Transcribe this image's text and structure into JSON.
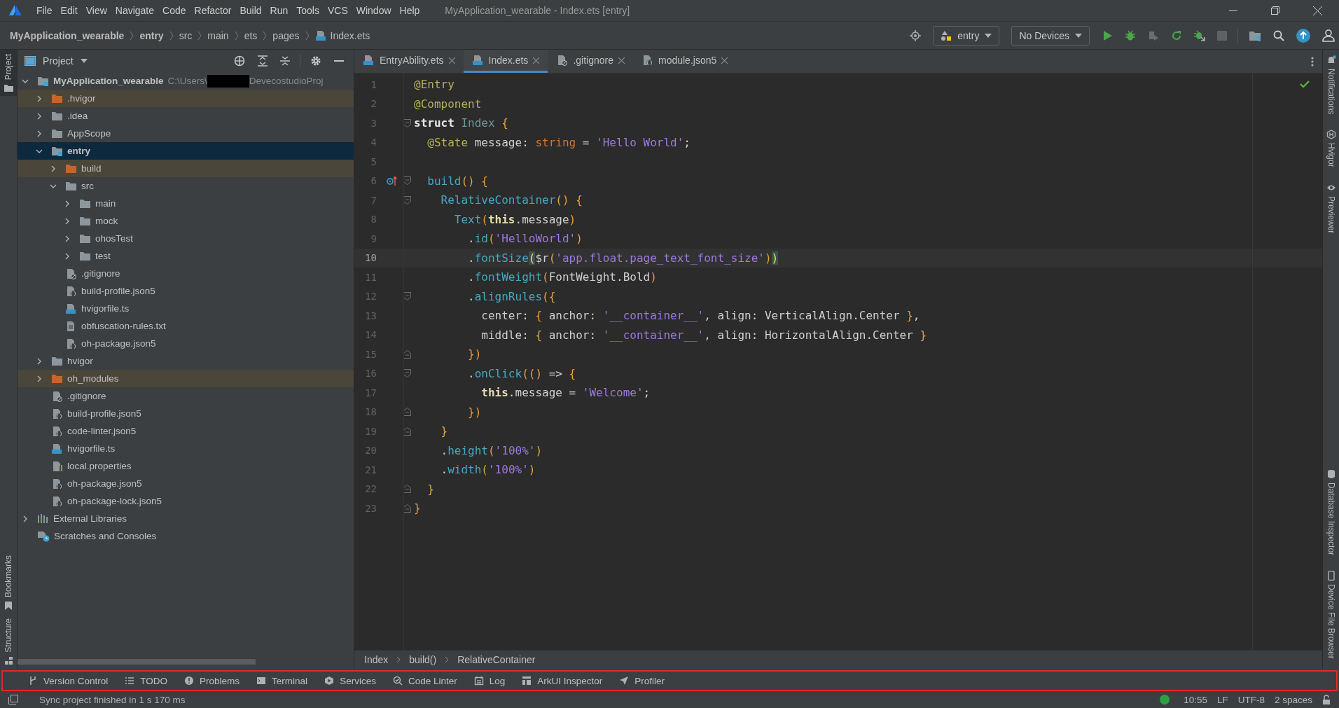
{
  "menu_bar": {
    "items": [
      "File",
      "Edit",
      "View",
      "Navigate",
      "Code",
      "Refactor",
      "Build",
      "Run",
      "Tools",
      "VCS",
      "Window",
      "Help"
    ],
    "title": "MyApplication_wearable - Index.ets [entry]"
  },
  "nav_bar": {
    "breadcrumbs": [
      {
        "text": "MyApplication_wearable",
        "kind": "project"
      },
      {
        "text": "entry",
        "kind": "module"
      },
      {
        "text": "src",
        "kind": "folder"
      },
      {
        "text": "main",
        "kind": "folder"
      },
      {
        "text": "ets",
        "kind": "folder"
      },
      {
        "text": "pages",
        "kind": "folder"
      },
      {
        "text": "Index.ets",
        "kind": "file"
      }
    ],
    "run_config": "entry",
    "device": "No Devices"
  },
  "left_strip_top": [
    {
      "label": "Project",
      "selected": true,
      "kind": "folder"
    }
  ],
  "left_strip_bottom": [
    {
      "label": "Bookmarks",
      "selected": false,
      "kind": "bookmark"
    },
    {
      "label": "Structure",
      "selected": false,
      "kind": "structure"
    }
  ],
  "project_panel": {
    "title": "Project",
    "tree": [
      {
        "name": "MyApplication_wearable",
        "kind": "project",
        "path_start": "C:\\Users\\",
        "redacted": true,
        "path_end": "DevecostudioProj",
        "expanded": true,
        "selected": false,
        "children": [
          {
            "name": ".hvigor",
            "kind": "excluded-folder",
            "expanded": false,
            "selected": false
          },
          {
            "name": ".idea",
            "kind": "folder",
            "expanded": false,
            "selected": false
          },
          {
            "name": "AppScope",
            "kind": "folder",
            "expanded": false,
            "selected": false
          },
          {
            "name": "entry",
            "kind": "module-folder",
            "expanded": true,
            "selected": true,
            "children": [
              {
                "name": "build",
                "kind": "excluded-folder",
                "expanded": false,
                "selected": false
              },
              {
                "name": "src",
                "kind": "folder",
                "expanded": true,
                "selected": false,
                "children": [
                  {
                    "name": "main",
                    "kind": "folder",
                    "expanded": false,
                    "selected": false
                  },
                  {
                    "name": "mock",
                    "kind": "folder",
                    "expanded": false,
                    "selected": false
                  },
                  {
                    "name": "ohosTest",
                    "kind": "folder",
                    "expanded": false,
                    "selected": false
                  },
                  {
                    "name": "test",
                    "kind": "folder",
                    "expanded": false,
                    "selected": false
                  }
                ]
              },
              {
                "name": ".gitignore",
                "kind": "file-ignore",
                "selected": false
              },
              {
                "name": "build-profile.json5",
                "kind": "file-json",
                "selected": false
              },
              {
                "name": "hvigorfile.ts",
                "kind": "file-ts",
                "selected": false
              },
              {
                "name": "obfuscation-rules.txt",
                "kind": "file-text",
                "selected": false
              },
              {
                "name": "oh-package.json5",
                "kind": "file-json",
                "selected": false
              }
            ]
          },
          {
            "name": "hvigor",
            "kind": "folder",
            "expanded": false,
            "selected": false
          },
          {
            "name": "oh_modules",
            "kind": "excluded-folder",
            "expanded": false,
            "selected": false
          },
          {
            "name": ".gitignore",
            "kind": "file-ignore",
            "selected": false
          },
          {
            "name": "build-profile.json5",
            "kind": "file-json",
            "selected": false
          },
          {
            "name": "code-linter.json5",
            "kind": "file-json",
            "selected": false
          },
          {
            "name": "hvigorfile.ts",
            "kind": "file-ts",
            "selected": false
          },
          {
            "name": "local.properties",
            "kind": "file-properties",
            "selected": false
          },
          {
            "name": "oh-package.json5",
            "kind": "file-json",
            "selected": false
          },
          {
            "name": "oh-package-lock.json5",
            "kind": "file-json",
            "selected": false
          }
        ]
      },
      {
        "name": "External Libraries",
        "kind": "libraries",
        "expanded": false,
        "selected": false
      },
      {
        "name": "Scratches and Consoles",
        "kind": "scratches",
        "selected": false
      }
    ]
  },
  "editor": {
    "tabs": [
      {
        "label": "EntryAbility.ets",
        "kind": "ets",
        "selected": false
      },
      {
        "label": "Index.ets",
        "kind": "ets",
        "selected": true
      },
      {
        "label": ".gitignore",
        "kind": "ignore",
        "selected": false
      },
      {
        "label": "module.json5",
        "kind": "json",
        "selected": false
      }
    ],
    "lines": [
      {
        "number": "1",
        "current": false,
        "kind": "plain",
        "tokens": [
          {
            "text": "@Entry",
            "kind": "ann"
          }
        ]
      },
      {
        "number": "2",
        "current": false,
        "kind": "plain",
        "tokens": [
          {
            "text": "@Component",
            "kind": "ann"
          }
        ]
      },
      {
        "number": "3",
        "current": false,
        "kind": "fold-start",
        "tokens": [
          {
            "text": "struct",
            "kind": "kw"
          },
          {
            "text": " Index",
            "kind": "cls"
          },
          {
            "text": " {",
            "kind": "br"
          }
        ]
      },
      {
        "number": "4",
        "current": false,
        "kind": "plain",
        "tokens": [
          {
            "text": "  @State",
            "kind": "ann"
          },
          {
            "text": " message: ",
            "kind": "plain"
          },
          {
            "text": "string",
            "kind": "type"
          },
          {
            "text": " = ",
            "kind": "plain"
          },
          {
            "text": "'Hello World'",
            "kind": "str"
          },
          {
            "text": ";",
            "kind": "plain"
          }
        ]
      },
      {
        "number": "5",
        "current": false,
        "kind": "plain"
      },
      {
        "number": "6",
        "current": false,
        "kind": "override-fold-start",
        "tokens": [
          {
            "text": "  build",
            "kind": "fn"
          },
          {
            "text": "() {",
            "kind": "br"
          }
        ]
      },
      {
        "number": "7",
        "current": false,
        "kind": "fold-start",
        "tokens": [
          {
            "text": "    RelativeContainer",
            "kind": "fn"
          },
          {
            "text": "() {",
            "kind": "br"
          }
        ]
      },
      {
        "number": "8",
        "current": false,
        "kind": "plain",
        "tokens": [
          {
            "text": "      Text",
            "kind": "fn"
          },
          {
            "text": "(",
            "kind": "br"
          },
          {
            "text": "this",
            "kind": "this"
          },
          {
            "text": ".message",
            "kind": "plain"
          },
          {
            "text": ")",
            "kind": "br"
          }
        ]
      },
      {
        "number": "9",
        "current": false,
        "kind": "plain",
        "tokens": [
          {
            "text": "        .",
            "kind": "plain"
          },
          {
            "text": "id",
            "kind": "fn"
          },
          {
            "text": "(",
            "kind": "br"
          },
          {
            "text": "'HelloWorld'",
            "kind": "str"
          },
          {
            "text": ")",
            "kind": "br"
          }
        ]
      },
      {
        "number": "10",
        "current": true,
        "kind": "plain",
        "tokens": [
          {
            "text": "        .",
            "kind": "plain"
          },
          {
            "text": "fontSize",
            "kind": "fn"
          },
          {
            "text": "(",
            "kind": "match"
          },
          {
            "text": "$r",
            "kind": "plain"
          },
          {
            "text": "(",
            "kind": "br"
          },
          {
            "text": "'app.float.page_text_font_size'",
            "kind": "str"
          },
          {
            "text": ")",
            "kind": "br"
          },
          {
            "text": ")",
            "kind": "match"
          }
        ]
      },
      {
        "number": "11",
        "current": false,
        "kind": "plain",
        "tokens": [
          {
            "text": "        .",
            "kind": "plain"
          },
          {
            "text": "fontWeight",
            "kind": "fn"
          },
          {
            "text": "(",
            "kind": "br"
          },
          {
            "text": "FontWeight.Bold",
            "kind": "plain"
          },
          {
            "text": ")",
            "kind": "br"
          }
        ]
      },
      {
        "number": "12",
        "current": false,
        "kind": "fold-start",
        "tokens": [
          {
            "text": "        .",
            "kind": "plain"
          },
          {
            "text": "alignRules",
            "kind": "fn"
          },
          {
            "text": "({",
            "kind": "br"
          }
        ]
      },
      {
        "number": "13",
        "current": false,
        "kind": "plain",
        "tokens": [
          {
            "text": "          center: ",
            "kind": "plain"
          },
          {
            "text": "{",
            "kind": "br"
          },
          {
            "text": " anchor: ",
            "kind": "plain"
          },
          {
            "text": "'__container__'",
            "kind": "str"
          },
          {
            "text": ", align: VerticalAlign.Center ",
            "kind": "plain"
          },
          {
            "text": "}",
            "kind": "br"
          },
          {
            "text": ",",
            "kind": "plain"
          }
        ]
      },
      {
        "number": "14",
        "current": false,
        "kind": "plain",
        "tokens": [
          {
            "text": "          middle: ",
            "kind": "plain"
          },
          {
            "text": "{",
            "kind": "br"
          },
          {
            "text": " anchor: ",
            "kind": "plain"
          },
          {
            "text": "'__container__'",
            "kind": "str"
          },
          {
            "text": ", align: HorizontalAlign.Center ",
            "kind": "plain"
          },
          {
            "text": "}",
            "kind": "br"
          }
        ]
      },
      {
        "number": "15",
        "current": false,
        "kind": "fold-end",
        "tokens": [
          {
            "text": "        })",
            "kind": "br"
          }
        ]
      },
      {
        "number": "16",
        "current": false,
        "kind": "fold-start",
        "tokens": [
          {
            "text": "        .",
            "kind": "plain"
          },
          {
            "text": "onClick",
            "kind": "fn"
          },
          {
            "text": "(()",
            "kind": "br"
          },
          {
            "text": " => ",
            "kind": "plain"
          },
          {
            "text": "{",
            "kind": "br"
          }
        ]
      },
      {
        "number": "17",
        "current": false,
        "kind": "plain",
        "tokens": [
          {
            "text": "          this",
            "kind": "this"
          },
          {
            "text": ".message = ",
            "kind": "plain"
          },
          {
            "text": "'Welcome'",
            "kind": "str"
          },
          {
            "text": ";",
            "kind": "plain"
          }
        ]
      },
      {
        "number": "18",
        "current": false,
        "kind": "fold-end",
        "tokens": [
          {
            "text": "        })",
            "kind": "br"
          }
        ]
      },
      {
        "number": "19",
        "current": false,
        "kind": "fold-end",
        "tokens": [
          {
            "text": "    }",
            "kind": "br"
          }
        ]
      },
      {
        "number": "20",
        "current": false,
        "kind": "plain",
        "tokens": [
          {
            "text": "    .",
            "kind": "plain"
          },
          {
            "text": "height",
            "kind": "fn"
          },
          {
            "text": "(",
            "kind": "br"
          },
          {
            "text": "'100%'",
            "kind": "str"
          },
          {
            "text": ")",
            "kind": "br"
          }
        ]
      },
      {
        "number": "21",
        "current": false,
        "kind": "plain",
        "tokens": [
          {
            "text": "    .",
            "kind": "plain"
          },
          {
            "text": "width",
            "kind": "fn"
          },
          {
            "text": "(",
            "kind": "br"
          },
          {
            "text": "'100%'",
            "kind": "str"
          },
          {
            "text": ")",
            "kind": "br"
          }
        ]
      },
      {
        "number": "22",
        "current": false,
        "kind": "fold-end",
        "tokens": [
          {
            "text": "  }",
            "kind": "br"
          }
        ]
      },
      {
        "number": "23",
        "current": false,
        "kind": "fold-end",
        "tokens": [
          {
            "text": "}",
            "kind": "br"
          }
        ]
      }
    ],
    "breadcrumbs": [
      "Index",
      "build()",
      "RelativeContainer"
    ]
  },
  "right_strip_top": [
    {
      "label": "Notifications",
      "kind": "bell"
    },
    {
      "label": "Hvigor",
      "kind": "hvigor"
    },
    {
      "label": "Previewer",
      "kind": "eye"
    }
  ],
  "right_strip_bottom": [
    {
      "label": "Database Inspector",
      "kind": "database"
    },
    {
      "label": "Device File Browser",
      "kind": "phone"
    }
  ],
  "tool_window_bar": {
    "highlighted": true,
    "items": [
      {
        "label": "Version Control",
        "kind": "vcs"
      },
      {
        "label": "TODO",
        "kind": "todo"
      },
      {
        "label": "Problems",
        "kind": "problems"
      },
      {
        "label": "Terminal",
        "kind": "terminal"
      },
      {
        "label": "Services",
        "kind": "services"
      },
      {
        "label": "Code Linter",
        "kind": "linter"
      },
      {
        "label": "Log",
        "kind": "log"
      },
      {
        "label": "ArkUI Inspector",
        "kind": "inspector"
      },
      {
        "label": "Profiler",
        "kind": "profiler"
      }
    ]
  },
  "status_bar": {
    "message": "Sync project finished in 1 s 170 ms",
    "position": "10:55",
    "line_separator": "LF",
    "encoding": "UTF-8",
    "indent": "2 spaces",
    "locked": false
  }
}
